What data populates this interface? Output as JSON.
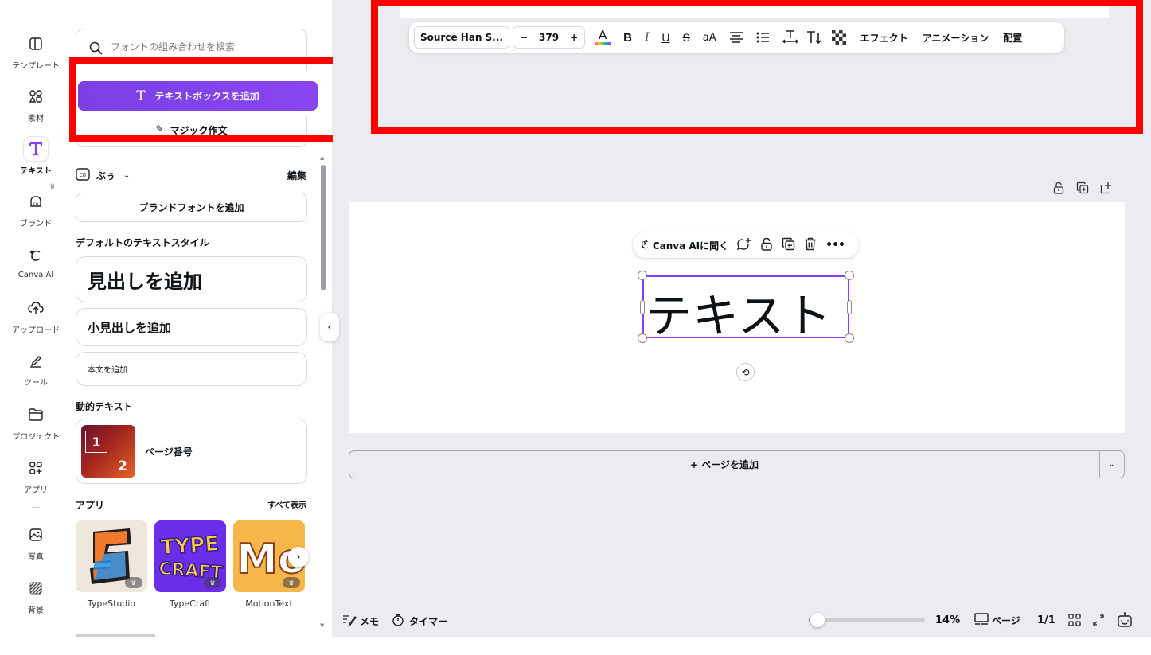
{
  "rail": {
    "items": [
      {
        "label": "テンプレート",
        "icon": "template-icon"
      },
      {
        "label": "素材",
        "icon": "elements-icon"
      },
      {
        "label": "テキスト",
        "icon": "text-icon"
      },
      {
        "label": "ブランド",
        "icon": "brand-icon"
      },
      {
        "label": "Canva AI",
        "icon": "canva-ai-icon"
      },
      {
        "label": "アップロード",
        "icon": "upload-icon"
      },
      {
        "label": "ツール",
        "icon": "tools-icon"
      },
      {
        "label": "プロジェクト",
        "icon": "folder-icon"
      },
      {
        "label": "アプリ",
        "icon": "apps-icon"
      },
      {
        "label": "写真",
        "icon": "photo-icon"
      },
      {
        "label": "背景",
        "icon": "background-icon"
      }
    ],
    "active": "テキスト"
  },
  "panel": {
    "search_placeholder": "フォントの組み合わせを検索",
    "add_textbox": "テキストボックスを追加",
    "magic_write": "マジック作文",
    "brand_name": "ぶぅ",
    "edit": "編集",
    "add_brand_font": "ブランドフォントを追加",
    "default_styles_title": "デフォルトのテキストスタイル",
    "add_heading": "見出しを追加",
    "add_subheading": "小見出しを追加",
    "add_body": "本文を追加",
    "dynamic_text_title": "動的テキスト",
    "page_number": "ページ番号",
    "page_number_thumb_1": "1",
    "page_number_thumb_2": "2",
    "apps_title": "アプリ",
    "see_all": "すべて表示",
    "apps": [
      {
        "name": "TypeStudio",
        "color": "#efe6dc"
      },
      {
        "name": "TypeCraft",
        "color": "#6b2ee8",
        "art": "TYPE CRAFT"
      },
      {
        "name": "MotionText",
        "color": "#f6b64a",
        "art": "Mo"
      }
    ]
  },
  "toolbar": {
    "font": "Source Han S...",
    "minus": "−",
    "size": "379",
    "plus": "+",
    "color_letter": "A",
    "bold": "B",
    "italic": "I",
    "underline": "U",
    "strike": "S",
    "case": "aA",
    "effects": "エフェクト",
    "animation": "アニメーション",
    "position": "配置"
  },
  "canvas": {
    "ai_label": "Canva AIに聞く",
    "text": "テキスト",
    "add_page": "+ ページを追加"
  },
  "bottom": {
    "notes": "メモ",
    "timer": "タイマー",
    "zoom": "14%",
    "zoom_fraction": 0.14,
    "pages_label": "ページ",
    "page_count": "1/1"
  },
  "colors": {
    "accent": "#8b3dff",
    "annotation": "#ff0000",
    "canvas_bg": "#ebecf0"
  }
}
